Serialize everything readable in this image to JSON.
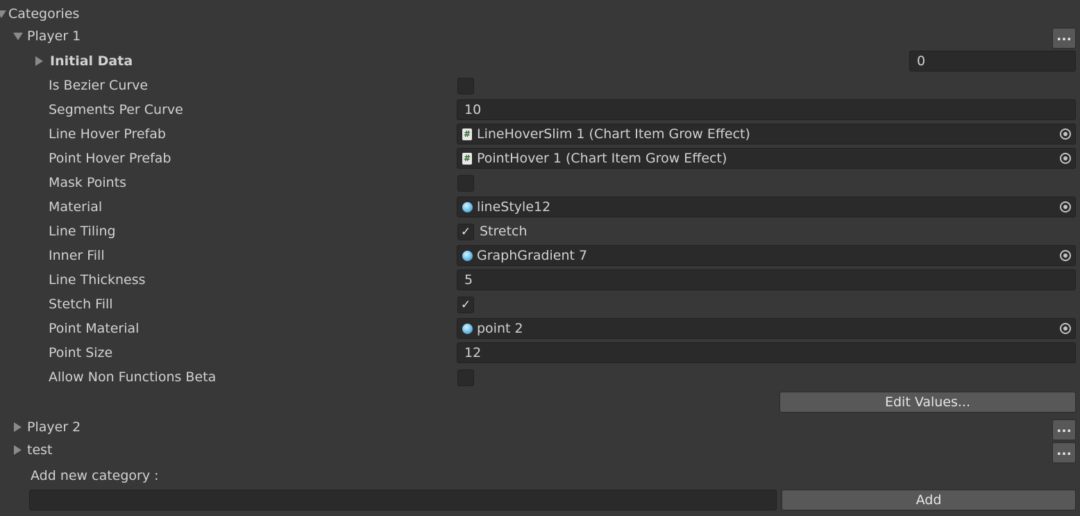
{
  "header": {
    "title": "Categories"
  },
  "player1": {
    "name": "Player 1",
    "more_label": "...",
    "initial_data": {
      "label": "Initial Data",
      "value": "0"
    },
    "properties": {
      "is_bezier_curve": {
        "label": "Is Bezier Curve",
        "checked": false
      },
      "segments_per_curve": {
        "label": "Segments Per Curve",
        "value": "10"
      },
      "line_hover_prefab": {
        "label": "Line Hover Prefab",
        "value": "LineHoverSlim 1 (Chart Item Grow Effect)",
        "icon": "script-icon"
      },
      "point_hover_prefab": {
        "label": "Point Hover Prefab",
        "value": "PointHover 1 (Chart Item Grow Effect)",
        "icon": "script-icon"
      },
      "mask_points": {
        "label": "Mask Points",
        "checked": false
      },
      "material": {
        "label": "Material",
        "value": "lineStyle12",
        "icon": "material-icon"
      },
      "line_tiling": {
        "label": "Line Tiling",
        "value": "Stretch",
        "checked": true
      },
      "inner_fill": {
        "label": "Inner Fill",
        "value": "GraphGradient 7",
        "icon": "material-icon"
      },
      "line_thickness": {
        "label": "Line Thickness",
        "value": "5"
      },
      "stetch_fill": {
        "label": "Stetch Fill",
        "checked": true
      },
      "point_material": {
        "label": "Point Material",
        "value": "point 2",
        "icon": "material-icon"
      },
      "point_size": {
        "label": "Point Size",
        "value": "12"
      },
      "allow_non_functions_beta": {
        "label": "Allow Non Functions Beta",
        "checked": false
      }
    },
    "edit_values_label": "Edit Values..."
  },
  "player2": {
    "name": "Player 2",
    "more_label": "..."
  },
  "test": {
    "name": "test",
    "more_label": "..."
  },
  "add_category": {
    "label": "Add new category :",
    "value": "",
    "button_label": "Add"
  },
  "colors": {
    "background": "#383838",
    "field": "#2a2a2a",
    "button": "#585858",
    "text": "#d2d2d2"
  }
}
